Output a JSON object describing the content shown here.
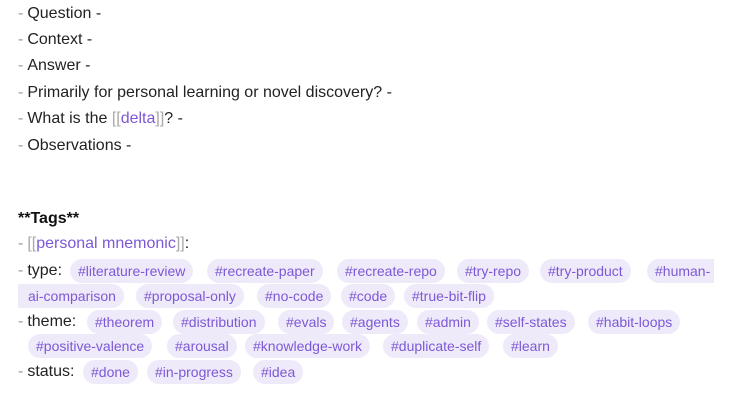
{
  "lines": [
    {
      "text": "Question -"
    },
    {
      "text": "Context -"
    },
    {
      "text": "Answer -"
    },
    {
      "text": "Primarily for personal learning or novel discovery? -"
    },
    {
      "before": "What is the ",
      "link": "delta",
      "after": "? -"
    },
    {
      "text": "Observations -"
    }
  ],
  "bullet": "-",
  "brackets": {
    "open": "[[",
    "close": "]]"
  },
  "tags_heading": "**Tags**",
  "mnemonic": {
    "link": "personal mnemonic",
    "after": ":"
  },
  "type": {
    "label": "type:",
    "tags": [
      "#literature-review",
      "#recreate-paper",
      "#recreate-repo",
      "#try-repo",
      "#try-product",
      "#human-",
      "ai-comparison",
      "#proposal-only",
      "#no-code",
      "#code",
      "#true-bit-flip"
    ]
  },
  "theme": {
    "label": "theme:",
    "tags": [
      "#theorem",
      "#distribution",
      "#evals",
      "#agents",
      "#admin",
      "#self-states",
      "#habit-loops",
      "#positive-valence",
      "#arousal",
      "#knowledge-work",
      "#duplicate-self",
      "#learn"
    ]
  },
  "status": {
    "label": "status:",
    "tags": [
      "#done",
      "#in-progress",
      "#idea"
    ]
  },
  "colors": {
    "tag_bg": "#efeafa",
    "tag_text": "#7d58d6",
    "link": "#7d58d6",
    "bracket": "#a8a8a8"
  }
}
